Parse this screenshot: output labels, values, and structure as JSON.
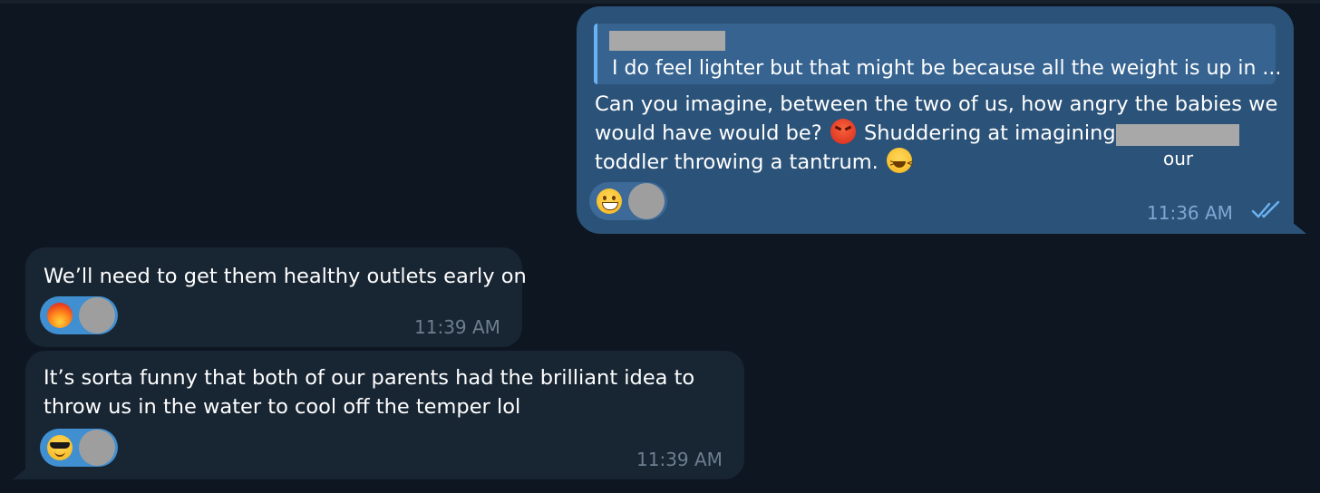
{
  "messages": {
    "outgoing": {
      "reply_preview": "I do feel lighter but that might be because all the weight is up in ...",
      "line1": "Can you imagine, between the two of us, how angry the babies we",
      "line2_before": "would have would be?",
      "line2_emoji": "angry-face-emoji",
      "line2_after": "Shuddering at imagining a",
      "line3": "toddler throwing a tantrum.",
      "line3_emoji": "laughing-squint-emoji",
      "overlay_word": "our",
      "reaction_emoji": "grinning-face-emoji",
      "time": "11:36 AM",
      "status": "read"
    },
    "incoming_1": {
      "text": "We’ll need to get them healthy outlets early on",
      "reaction_emoji": "fire-emoji",
      "time": "11:39 AM"
    },
    "incoming_2": {
      "line1": "It’s sorta funny that both of our parents had the brilliant idea to",
      "line2": "throw us in the water to cool off the temper lol",
      "reaction_emoji": "sunglasses-face-emoji",
      "time": "11:39 AM"
    }
  },
  "colors": {
    "background": "#0e1621",
    "outgoing_bubble": "#2b5278",
    "incoming_bubble": "#182533",
    "accent": "#6ab3f3"
  }
}
